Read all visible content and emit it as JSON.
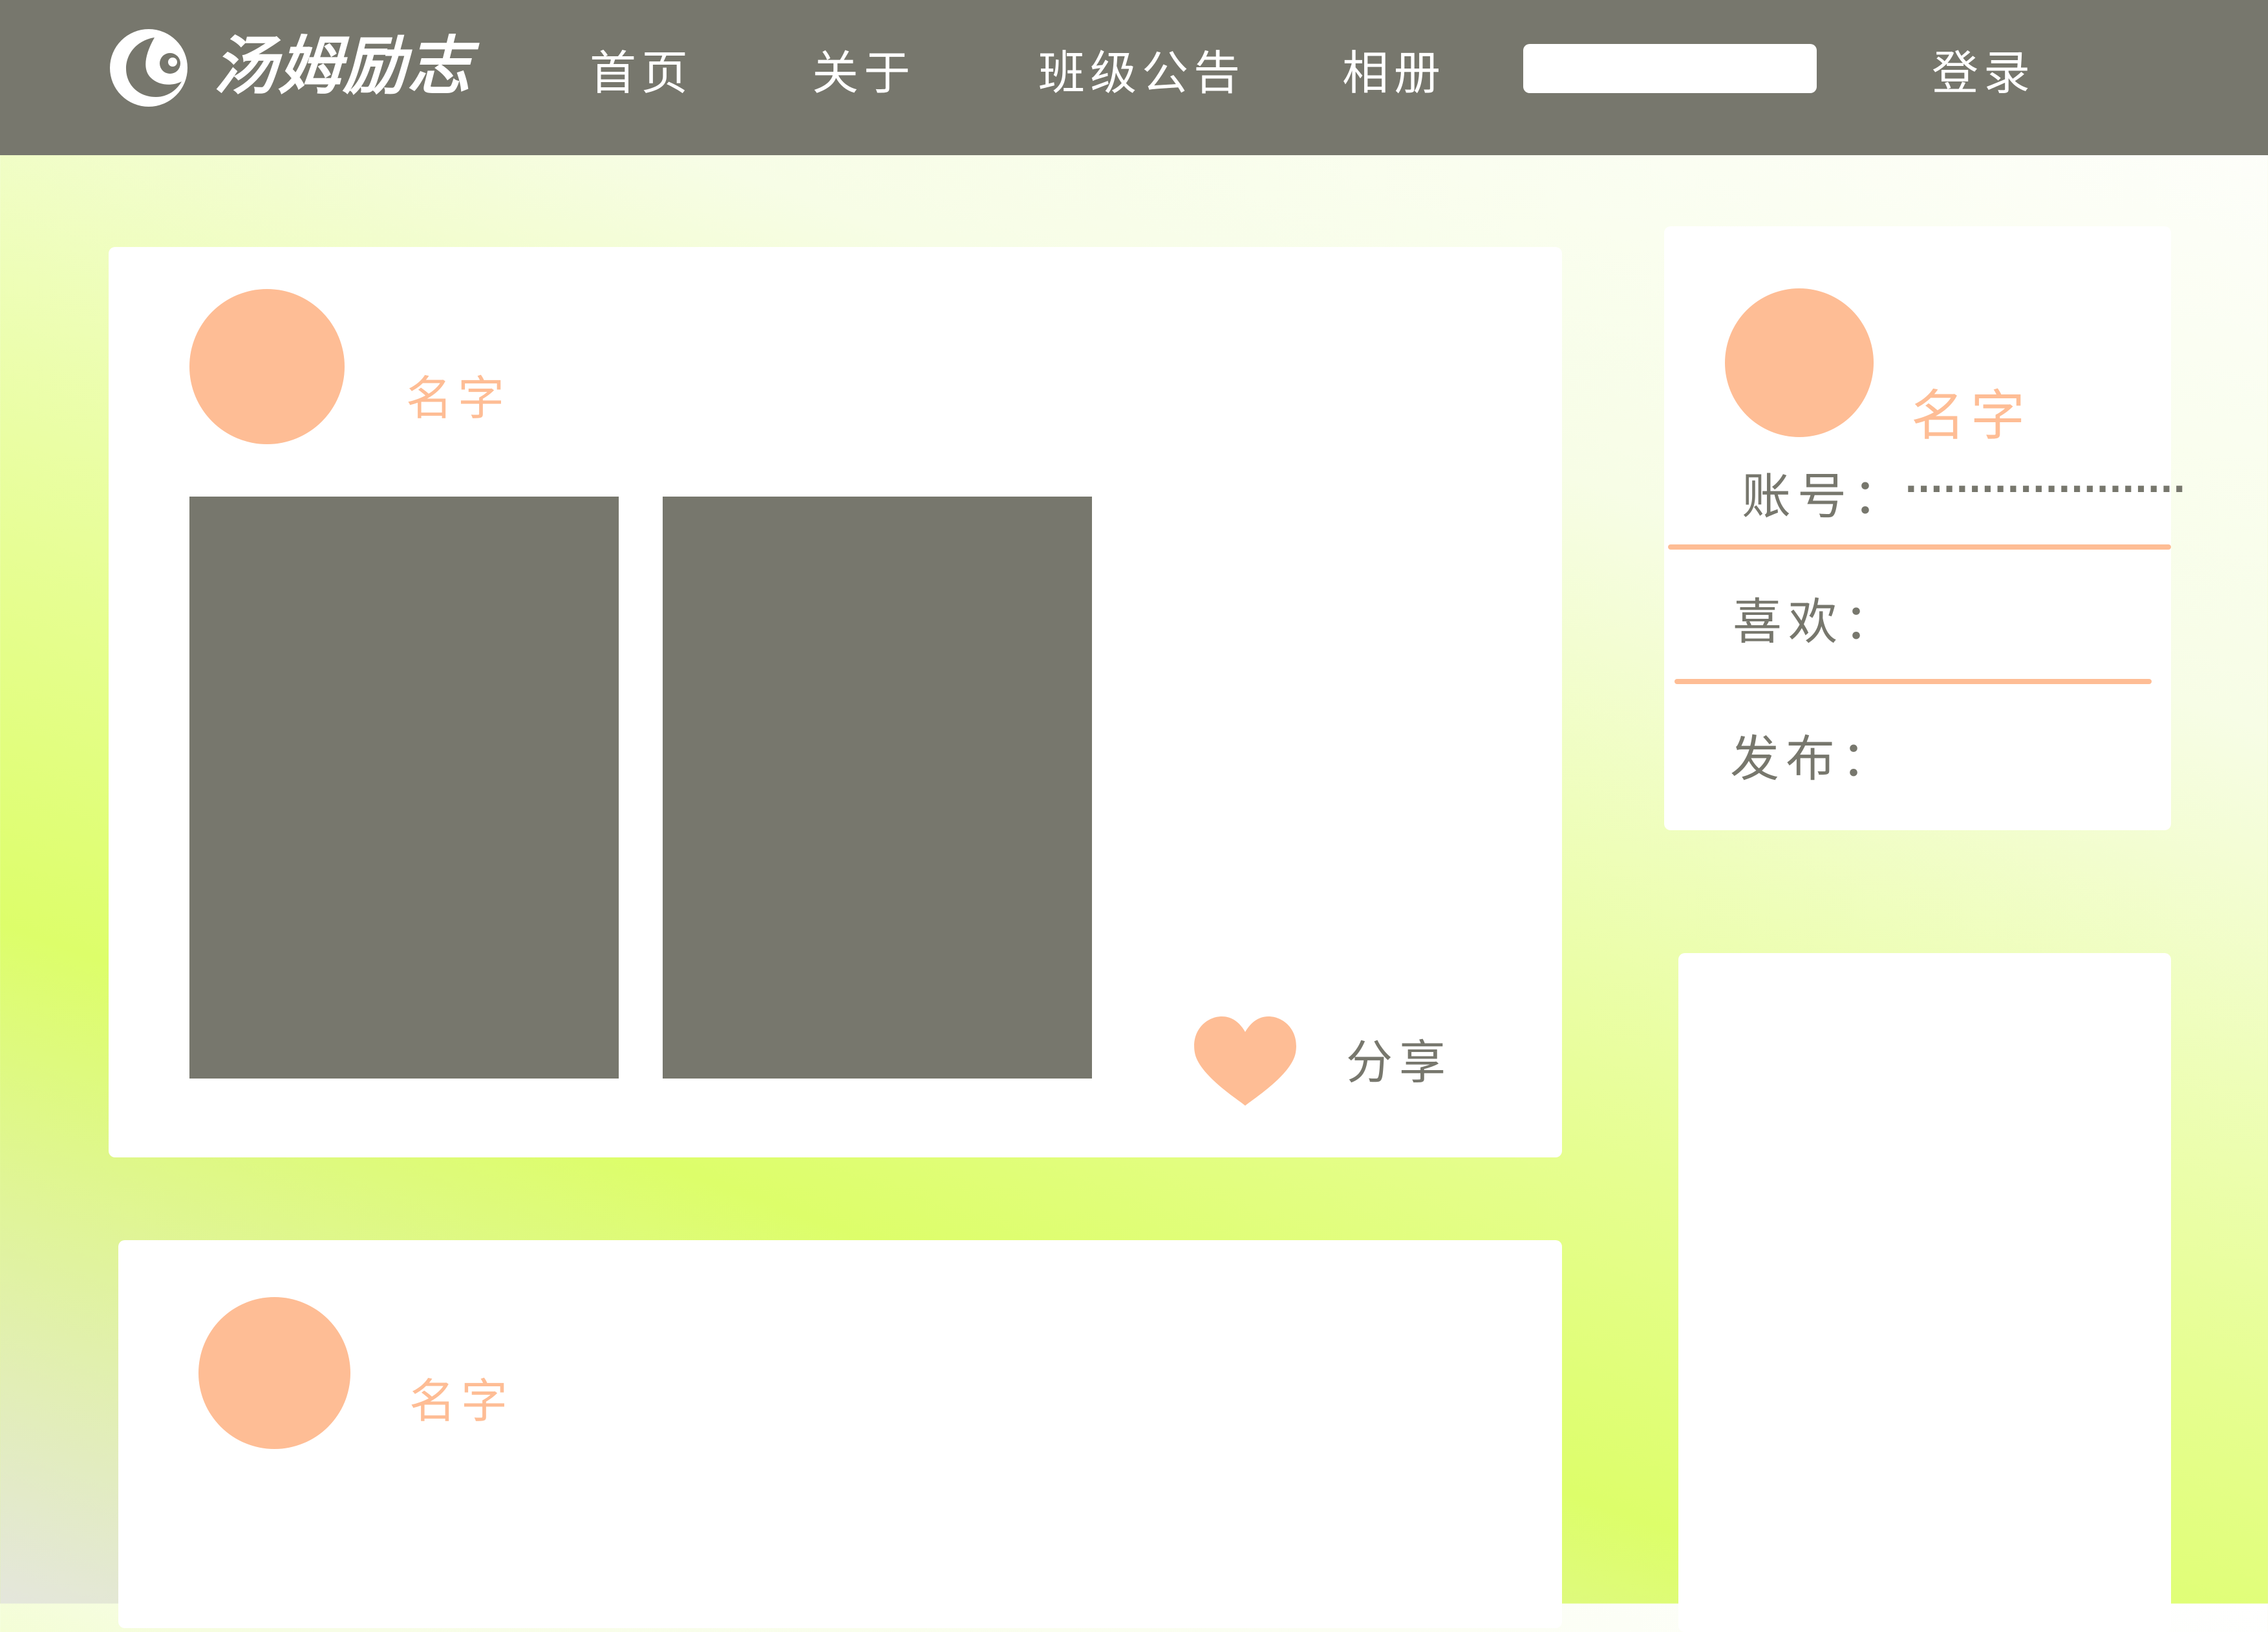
{
  "header": {
    "logo_text": "汤姆励志",
    "nav_items": [
      "首页",
      "关于",
      "班级公告",
      "相册"
    ],
    "search": {
      "value": "",
      "placeholder": ""
    },
    "login_label": "登录"
  },
  "posts": [
    {
      "author": "名字",
      "photo_count": 2,
      "share_label": "分享"
    },
    {
      "author": "名字"
    }
  ],
  "profile": {
    "name": "名字",
    "account_label": "账号：",
    "account_value": "......................",
    "likes_label": "喜欢：",
    "posts_label": "发布："
  },
  "colors": {
    "nav_bg": "#77776d",
    "accent": "#febd95",
    "card_bg": "#ffffff",
    "text_gray": "#77776d"
  },
  "icons": {
    "logo": "logo-icon",
    "like": "heart-icon"
  }
}
